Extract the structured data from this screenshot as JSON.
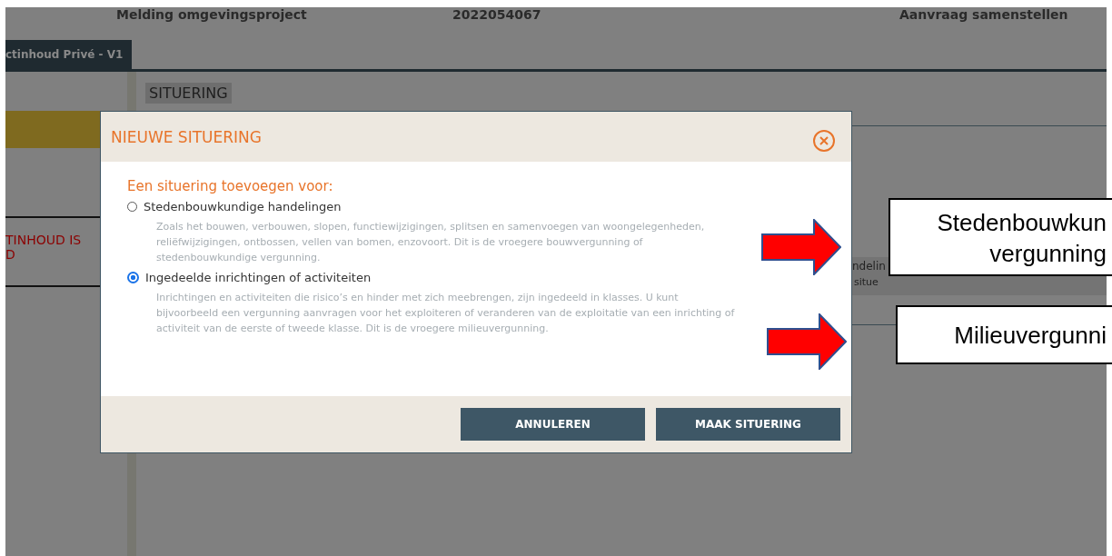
{
  "header": {
    "project_type": "Melding omgevingsproject",
    "project_number": "2022054067",
    "status": "Aanvraag samenstellen"
  },
  "tab": {
    "label": "ctinhoud Privé - V1",
    "selected": true
  },
  "section_title": "SITUERING",
  "sidebar": {
    "warning_lines": [
      "TINHOUD IS",
      "D"
    ]
  },
  "background_row": {
    "texts": [
      "ndelin",
      "situe"
    ]
  },
  "dialog": {
    "title": "NIEUWE SITUERING",
    "prompt": "Een situering toevoegen voor:",
    "options": [
      {
        "label": "Stedenbouwkundige handelingen",
        "description": "Zoals het bouwen, verbouwen, slopen, functiewijzigingen, splitsen en samenvoegen van woongelegenheden, reliëfwijzigingen, ontbossen, vellen van bomen, enzovoort. Dit is de vroegere bouwvergunning of stedenbouwkundige vergunning.",
        "selected": false
      },
      {
        "label": "Ingedeelde inrichtingen of activiteiten",
        "description": "Inrichtingen en activiteiten die risico’s en hinder met zich meebrengen, zijn ingedeeld in klasses. U kunt bijvoorbeeld een vergunning aanvragen voor het exploiteren of veranderen van de exploitatie van een inrichting of activiteit van de eerste of tweede klasse. Dit is de vroegere milieuvergunning.",
        "selected": true
      }
    ],
    "buttons": [
      "ANNULEREN",
      "MAAK SITUERING"
    ]
  },
  "annotations": [
    {
      "lines": [
        "Stedenbouwkun",
        "vergunning"
      ]
    },
    {
      "lines": [
        "Milieuvergunni"
      ]
    }
  ]
}
